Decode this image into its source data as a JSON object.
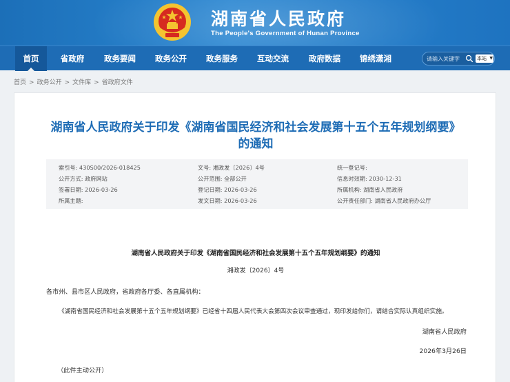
{
  "header": {
    "title": "湖南省人民政府",
    "subtitle": "The People's Government of Hunan Province"
  },
  "nav": {
    "items": [
      "首页",
      "省政府",
      "政务要闻",
      "政务公开",
      "政务服务",
      "互动交流",
      "政府数据",
      "锦绣潇湘"
    ],
    "active_index": 0
  },
  "search": {
    "placeholder": "请输入关键字",
    "scope": "本站"
  },
  "breadcrumb": [
    "首页",
    "政务公开",
    "文件库",
    "省政府文件"
  ],
  "breadcrumb_sep": ">",
  "document": {
    "title_line1": "湖南省人民政府关于印发《湖南省国民经济和社会发展第十五个五年规划纲要》",
    "title_line2": "的通知",
    "meta": {
      "index_no": "索引号: 430S00/2026-018425",
      "doc_no": "文号: 湘政发〔2026〕4号",
      "unified_reg_no": "统一登记号:",
      "publish_mode": "公开方式: 政府网站",
      "publish_scope": "公开范围: 全部公开",
      "valid_until": "信息时效期: 2030-12-31",
      "sign_date": "签署日期: 2026-03-26",
      "register_date": "登记日期: 2026-03-26",
      "agency": "所属机构: 湖南省人民政府",
      "subject": "所属主题:",
      "release_date": "发文日期: 2026-03-26",
      "responsible_dept": "公开责任部门: 湖南省人民政府办公厅"
    },
    "heading": "湖南省人民政府关于印发《湖南省国民经济和社会发展第十五个五年规划纲要》的通知",
    "number": "湘政发〔2026〕4号",
    "salutation": "各市州、县市区人民政府，省政府各厅委、各直属机构：",
    "paragraph": "《湖南省国民经济和社会发展第十五个五年规划纲要》已经省十四届人民代表大会第四次会议审查通过，现印发给你们，请结合实际认真组织实施。",
    "signatory": "湖南省人民政府",
    "date": "2026年3月26日",
    "note": "（此件主动公开）"
  },
  "colors": {
    "header_blue": "#1c6fb8",
    "nav_blue": "#1e6cb5",
    "title_blue": "#1e6cb5",
    "emblem_red": "#d62a20",
    "emblem_gold": "#f4c430"
  }
}
